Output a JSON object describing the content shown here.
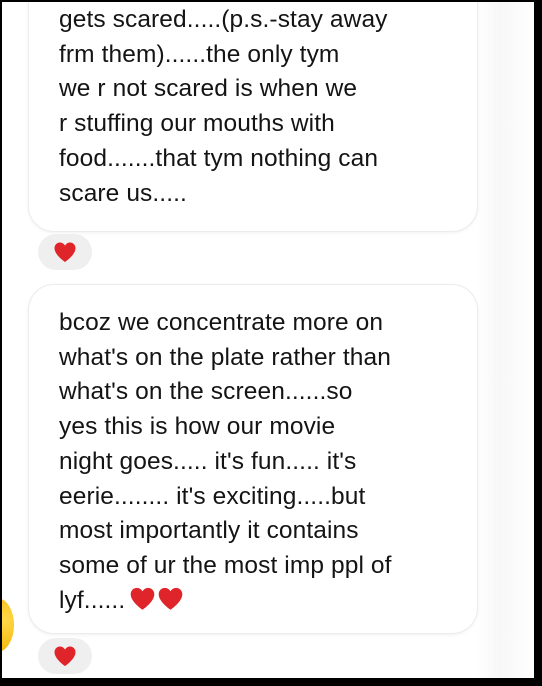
{
  "messages": [
    {
      "text": "gets scared.....(p.s.-stay away\nfrm them)......the only tym\nwe r not scared is when we\nr stuffing our mouths with\nfood.......that tym nothing can\nscare us.....",
      "reaction": "red-heart"
    },
    {
      "text": "bcoz we concentrate more on\nwhat's on the plate rather than\nwhat's on the screen......so\nyes this is how our movie\nnight goes..... it's fun..... it's\neerie........ it's exciting.....but\nmost importantly it contains\nsome of ur the most imp ppl of\nlyf......",
      "inline_emoji": [
        "red-heart",
        "red-heart"
      ],
      "reaction": "red-heart"
    }
  ],
  "colors": {
    "heart": "#e0252a",
    "bubble_border": "#ececec",
    "reaction_bg": "#efefef",
    "text": "#141414"
  }
}
